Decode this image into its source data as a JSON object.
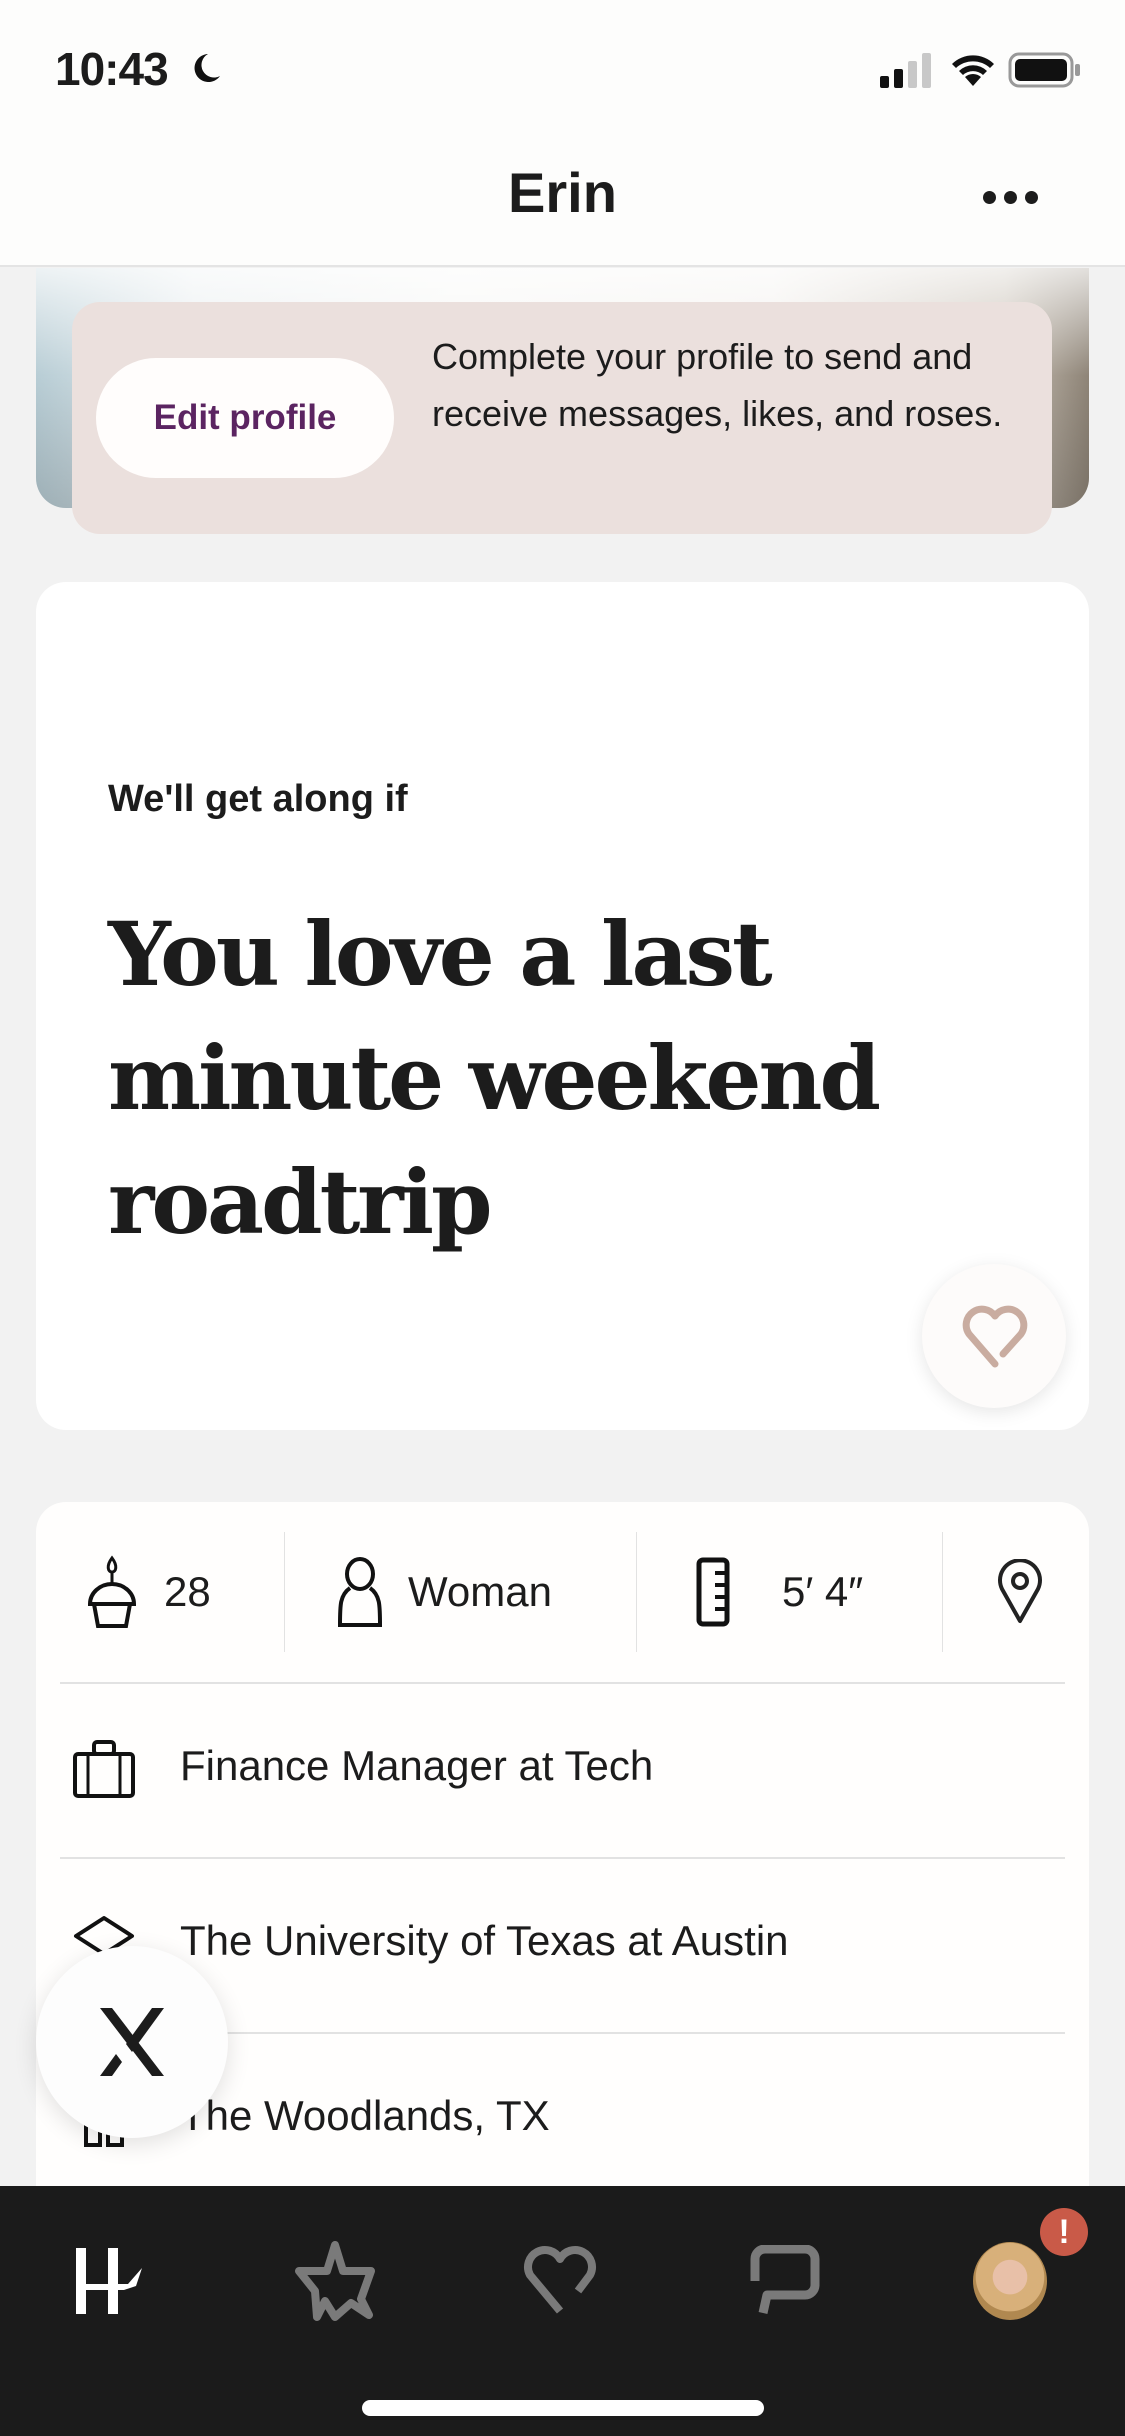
{
  "status_bar": {
    "time": "10:43",
    "focus_icon": "moon-icon",
    "signal": "cellular-signal-icon",
    "wifi": "wifi-icon",
    "battery": "battery-icon"
  },
  "header": {
    "title": "Erin",
    "more_icon": "more-horizontal-icon"
  },
  "banner": {
    "button_label": "Edit profile",
    "message": "Complete your profile to send and receive messages, likes, and roses."
  },
  "prompt": {
    "label": "We'll get along if",
    "answer": "You love a last minute weekend roadtrip",
    "like_icon": "heart-icon"
  },
  "vitals": [
    {
      "icon": "birthday-cake-icon",
      "value": "28"
    },
    {
      "icon": "person-icon",
      "value": "Woman"
    },
    {
      "icon": "ruler-icon",
      "value": "5′ 4″"
    },
    {
      "icon": "location-pin-icon",
      "value": ""
    }
  ],
  "details": [
    {
      "icon": "briefcase-icon",
      "value": "Finance Manager at Tech"
    },
    {
      "icon": "graduation-cap-icon",
      "value": "The University of Texas at Austin"
    },
    {
      "icon": "home-icon",
      "value": "The Woodlands, TX"
    }
  ],
  "dismiss_icon": "close-x-icon",
  "tabbar": {
    "tabs": [
      {
        "name": "discover",
        "icon": "hinge-logo-icon",
        "active": true
      },
      {
        "name": "standouts",
        "icon": "star-icon",
        "active": false
      },
      {
        "name": "likes-you",
        "icon": "heart-icon",
        "active": false
      },
      {
        "name": "matches",
        "icon": "chat-bubble-icon",
        "active": false
      },
      {
        "name": "profile",
        "icon": "avatar",
        "active": false
      }
    ],
    "profile_badge": "!"
  },
  "colors": {
    "accent": "#5b2461",
    "banner_bg": "#ebe0dd",
    "like_heart": "#c9aca0",
    "badge": "#c95a48",
    "tabbar_bg": "#1b1b1b",
    "tab_inactive": "#7a7a7a"
  }
}
